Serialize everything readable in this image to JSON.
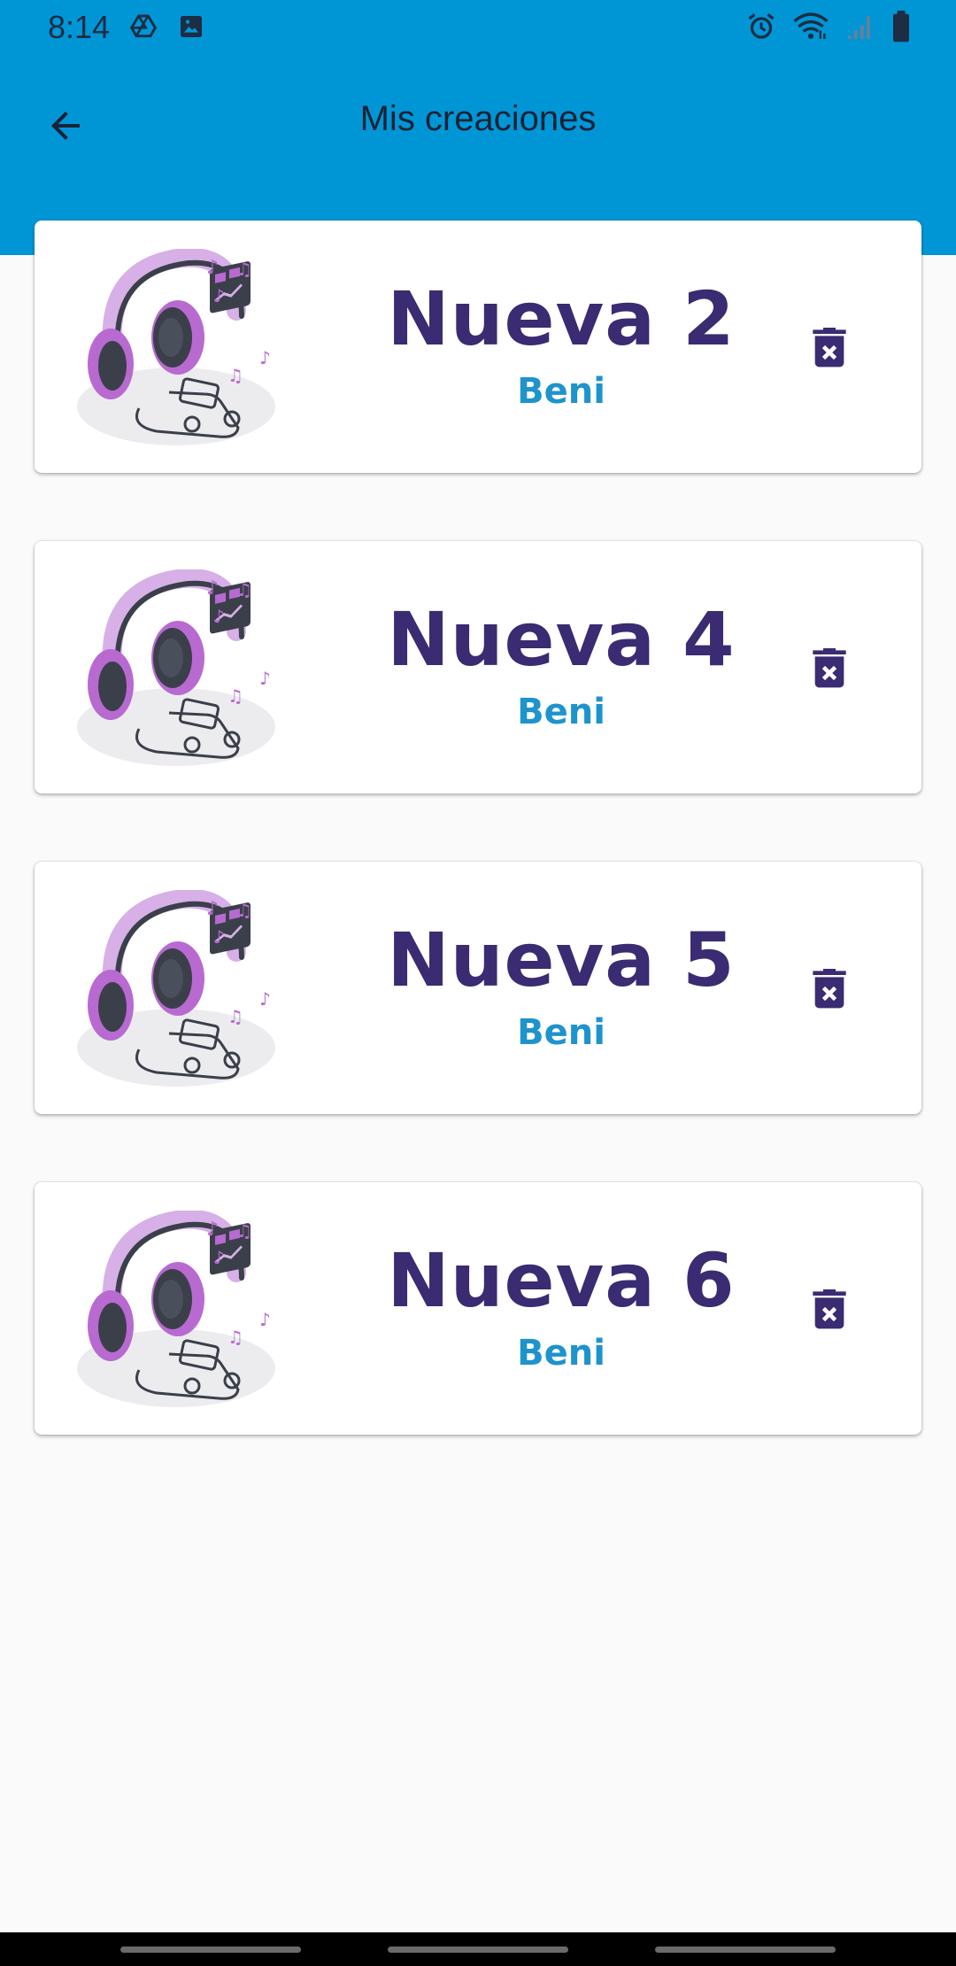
{
  "status_bar": {
    "time": "8:14",
    "left_icons": [
      "drive-icon",
      "image-icon"
    ],
    "right_icons": [
      "alarm-icon",
      "wifi-icon",
      "signal-icon",
      "battery-icon"
    ]
  },
  "app_bar": {
    "title": "Mis creaciones",
    "back_icon": "arrow-back-icon"
  },
  "creations": [
    {
      "title": "Nueva 2",
      "author": "Beni"
    },
    {
      "title": "Nueva 4",
      "author": "Beni"
    },
    {
      "title": "Nueva 5",
      "author": "Beni"
    },
    {
      "title": "Nueva 6",
      "author": "Beni"
    }
  ],
  "colors": {
    "app_bar": "#0096d6",
    "title_text": "#3a2b72",
    "subtitle_text": "#1e93cc",
    "delete_icon": "#3a2b72",
    "background": "#fafafa"
  }
}
